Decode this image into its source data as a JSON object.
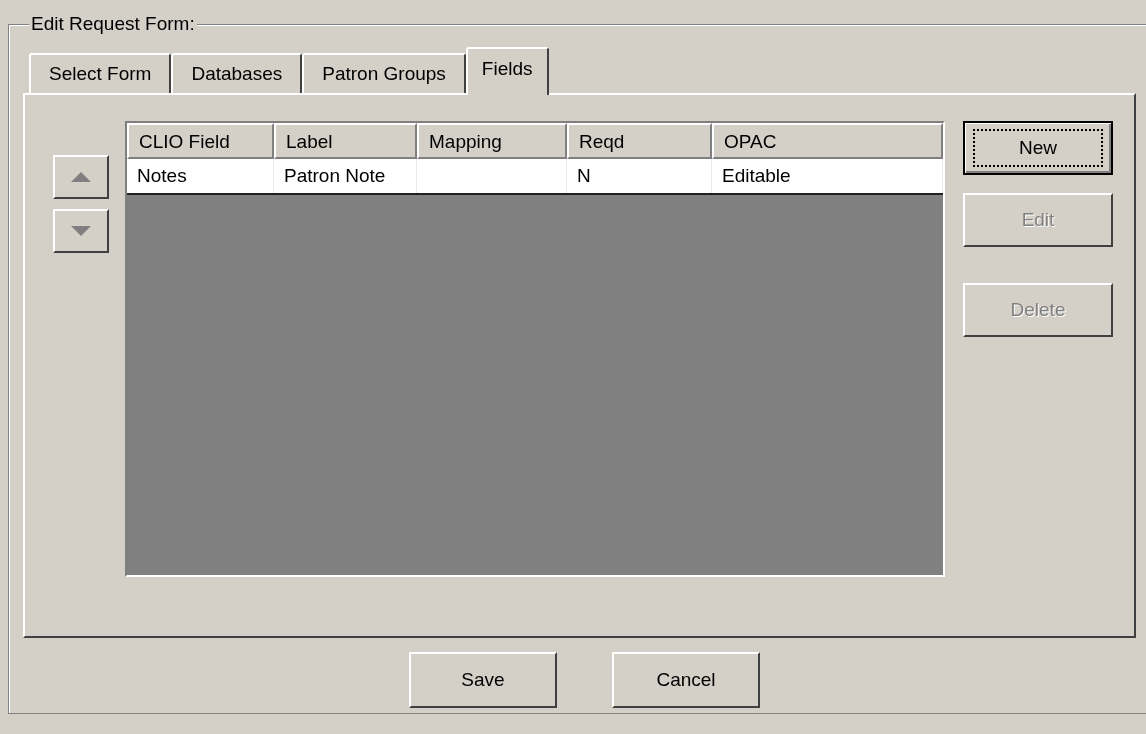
{
  "group_title": "Edit  Request Form:",
  "tabs": [
    {
      "label": "Select Form",
      "selected": false
    },
    {
      "label": "Databases",
      "selected": false
    },
    {
      "label": "Patron Groups",
      "selected": false
    },
    {
      "label": "Fields",
      "selected": true
    }
  ],
  "move_buttons": [
    {
      "kind": "up",
      "disabled": true
    },
    {
      "kind": "down",
      "disabled": true
    }
  ],
  "table": {
    "columns": [
      "CLIO Field",
      "Label",
      "Mapping",
      "Reqd",
      "OPAC"
    ],
    "rows": [
      [
        "Notes",
        "Patron Note",
        "",
        "N",
        "Editable"
      ]
    ]
  },
  "side_buttons": [
    {
      "label": "New",
      "disabled": false,
      "default": true
    },
    {
      "label": "Edit",
      "disabled": true,
      "default": false
    },
    {
      "label": "Delete",
      "disabled": true,
      "default": false
    }
  ],
  "footer_buttons": [
    {
      "label": "Save"
    },
    {
      "label": "Cancel"
    }
  ]
}
